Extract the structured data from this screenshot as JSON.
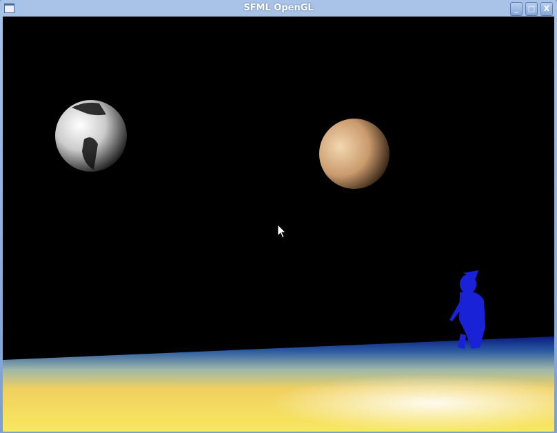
{
  "window": {
    "title": "SFML OpenGL",
    "minimize_label": "_",
    "maximize_label": "□",
    "close_label": "X"
  },
  "colors": {
    "titlebar": "#8eaedf",
    "background": "#000000",
    "character": "#1a22d8"
  }
}
